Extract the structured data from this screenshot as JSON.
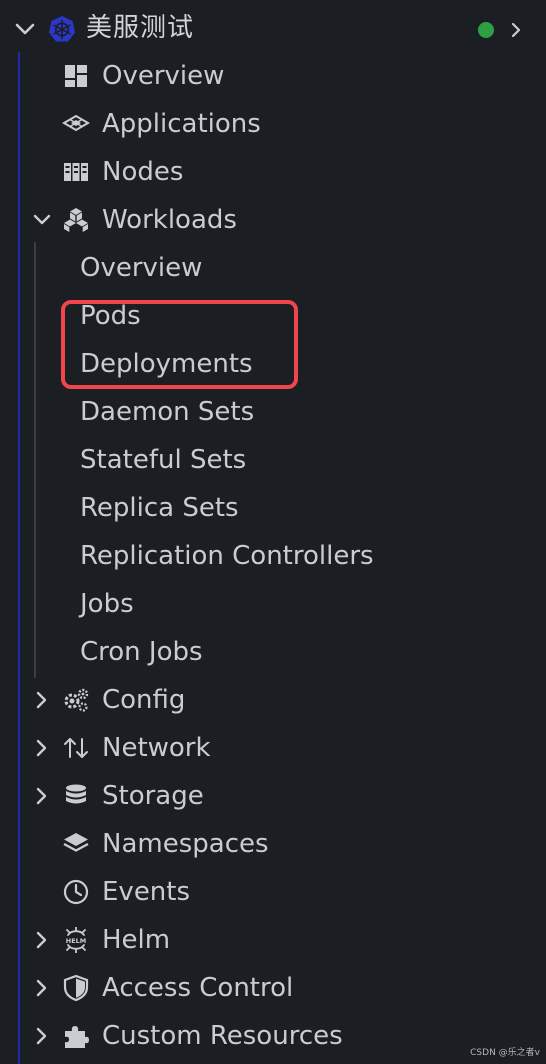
{
  "cluster": {
    "name": "美服测试",
    "status_color": "#2ea043",
    "icon": "kubernetes-icon",
    "accent": "#1f2aa8"
  },
  "top_items": [
    {
      "label": "Overview",
      "icon": "dashboard-icon"
    },
    {
      "label": "Applications",
      "icon": "applications-icon"
    },
    {
      "label": "Nodes",
      "icon": "nodes-icon"
    }
  ],
  "workloads": {
    "label": "Workloads",
    "icon": "workloads-icon",
    "expanded": true,
    "children": [
      "Overview",
      "Pods",
      "Deployments",
      "Daemon Sets",
      "Stateful Sets",
      "Replica Sets",
      "Replication Controllers",
      "Jobs",
      "Cron Jobs"
    ]
  },
  "bottom_items": [
    {
      "label": "Config",
      "icon": "config-icon",
      "expandable": true
    },
    {
      "label": "Network",
      "icon": "network-icon",
      "expandable": true
    },
    {
      "label": "Storage",
      "icon": "storage-icon",
      "expandable": true
    },
    {
      "label": "Namespaces",
      "icon": "namespaces-icon",
      "expandable": false
    },
    {
      "label": "Events",
      "icon": "events-icon",
      "expandable": false
    },
    {
      "label": "Helm",
      "icon": "helm-icon",
      "expandable": true
    },
    {
      "label": "Access Control",
      "icon": "access-control-icon",
      "expandable": true
    },
    {
      "label": "Custom Resources",
      "icon": "custom-resources-icon",
      "expandable": true
    }
  ],
  "highlight_color": "#f0464b",
  "watermark": "CSDN @乐之者v"
}
